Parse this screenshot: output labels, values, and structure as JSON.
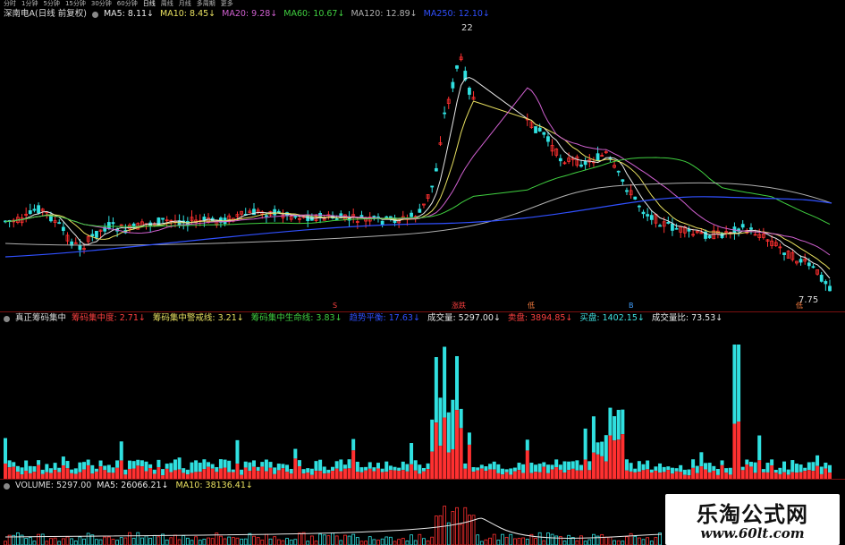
{
  "toolbar": {
    "tabs": [
      "分时",
      "1分钟",
      "5分钟",
      "15分钟",
      "30分钟",
      "60分钟",
      "日线",
      "周线",
      "月线",
      "多周期",
      "更多"
    ],
    "active_index": 6
  },
  "main_legend": {
    "title": "深南电A(日线 前复权)",
    "items": [
      {
        "text": "MA5: 8.11",
        "color": "#e8e8e8"
      },
      {
        "text": "MA10: 8.45",
        "color": "#e8e060"
      },
      {
        "text": "MA20: 9.28",
        "color": "#d060d0"
      },
      {
        "text": "MA60: 10.67",
        "color": "#40d040"
      },
      {
        "text": "MA120: 12.89",
        "color": "#b0b0b0"
      },
      {
        "text": "MA250: 12.10",
        "color": "#3050ff"
      }
    ]
  },
  "price_labels": {
    "high": "22",
    "low": "7.75"
  },
  "chip_legend": {
    "title": "真正筹码集中",
    "items": [
      {
        "text": "筹码集中度: 2.71",
        "color": "#ff4040"
      },
      {
        "text": "筹码集中警戒线: 3.21",
        "color": "#e8e060"
      },
      {
        "text": "筹码集中生命线: 3.83",
        "color": "#40d040"
      },
      {
        "text": "趋势平衡: 17.63",
        "color": "#3050ff"
      },
      {
        "text": "成交量: 5297.00",
        "color": "#e8e8e8"
      },
      {
        "text": "卖盘: 3894.85",
        "color": "#ff4040"
      },
      {
        "text": "买盘: 1402.15",
        "color": "#40e0e0"
      },
      {
        "text": "成交量比: 73.53",
        "color": "#e8e8e8"
      }
    ]
  },
  "volume_legend": {
    "title": "VOLUME: 5297.00",
    "items": [
      {
        "text": "MA5: 26066.21",
        "color": "#e8e8e8"
      },
      {
        "text": "MA10: 38136.41",
        "color": "#e8e060"
      }
    ]
  },
  "markers": {
    "left": "S",
    "mid1": "涨跌",
    "mid2": "低",
    "right1": "B",
    "right2": "低"
  },
  "watermark": {
    "title": "乐淘公式网",
    "url": "www.60lt.com"
  },
  "colors": {
    "up": "#ff3030",
    "down": "#30e0e0",
    "bg": "#000000",
    "separator": "#7a1010"
  }
}
